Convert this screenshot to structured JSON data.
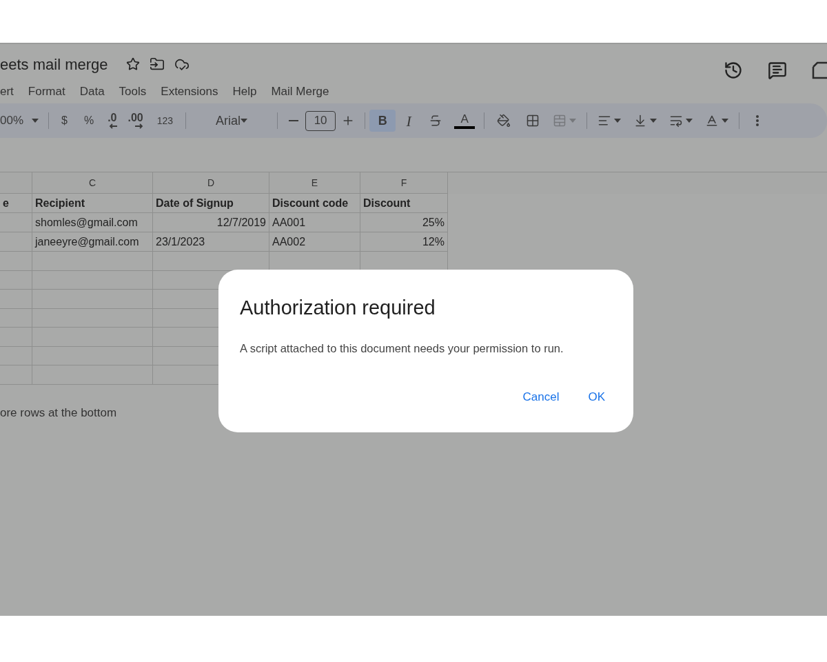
{
  "document": {
    "title": "eets mail merge"
  },
  "menu": [
    "ert",
    "Format",
    "Data",
    "Tools",
    "Extensions",
    "Help",
    "Mail Merge"
  ],
  "toolbar": [
    {
      "kind": "dropdown",
      "label": "00%"
    },
    {
      "kind": "divider"
    },
    {
      "kind": "text",
      "label": "$"
    },
    {
      "kind": "text",
      "label": "%"
    },
    {
      "kind": "decimal-decrease",
      "label": ".0"
    },
    {
      "kind": "decimal-increase",
      "label": ".00"
    },
    {
      "kind": "text",
      "label": "123"
    },
    {
      "kind": "divider"
    },
    {
      "kind": "font",
      "label": "Arial"
    },
    {
      "kind": "divider"
    },
    {
      "kind": "minus"
    },
    {
      "kind": "size",
      "label": "10"
    },
    {
      "kind": "plus"
    },
    {
      "kind": "divider"
    },
    {
      "kind": "bold",
      "label": "B",
      "selected": true
    },
    {
      "kind": "italic",
      "label": "I",
      "selected": false
    },
    {
      "kind": "strike"
    },
    {
      "kind": "textcolor",
      "label": "A"
    },
    {
      "kind": "divider"
    },
    {
      "kind": "fill"
    },
    {
      "kind": "borders"
    },
    {
      "kind": "merge",
      "disabled": true
    },
    {
      "kind": "divider"
    },
    {
      "kind": "align"
    },
    {
      "kind": "valign"
    },
    {
      "kind": "wrap"
    },
    {
      "kind": "rotate"
    },
    {
      "kind": "divider"
    },
    {
      "kind": "more"
    }
  ],
  "sheet": {
    "columns": [
      "",
      "C",
      "D",
      "E",
      "F"
    ],
    "rows": [
      [
        {
          "text": "e",
          "bold": true
        },
        {
          "text": "Recipient",
          "bold": true
        },
        {
          "text": "Date of Signup",
          "bold": true
        },
        {
          "text": "Discount code",
          "bold": true
        },
        {
          "text": "Discount",
          "bold": true
        }
      ],
      [
        {
          "text": ""
        },
        {
          "text": "shomles@gmail.com",
          "right_aligned": false
        },
        {
          "text": "12/7/2019",
          "right_aligned": true
        },
        {
          "text": "AA001",
          "right_aligned": false
        },
        {
          "text": "25%",
          "right_aligned": true
        }
      ],
      [
        {
          "text": ""
        },
        {
          "text": "janeeyre@gmail.com",
          "right_aligned": false
        },
        {
          "text": "23/1/2023",
          "right_aligned": false
        },
        {
          "text": "AA002",
          "right_aligned": false
        },
        {
          "text": "12%",
          "right_aligned": true
        }
      ]
    ],
    "footer": "ore rows at the bottom"
  },
  "dialog": {
    "title": "Authorization required",
    "message": "A script attached to this document needs your permission to run.",
    "buttons": [
      "Cancel",
      "OK"
    ]
  }
}
